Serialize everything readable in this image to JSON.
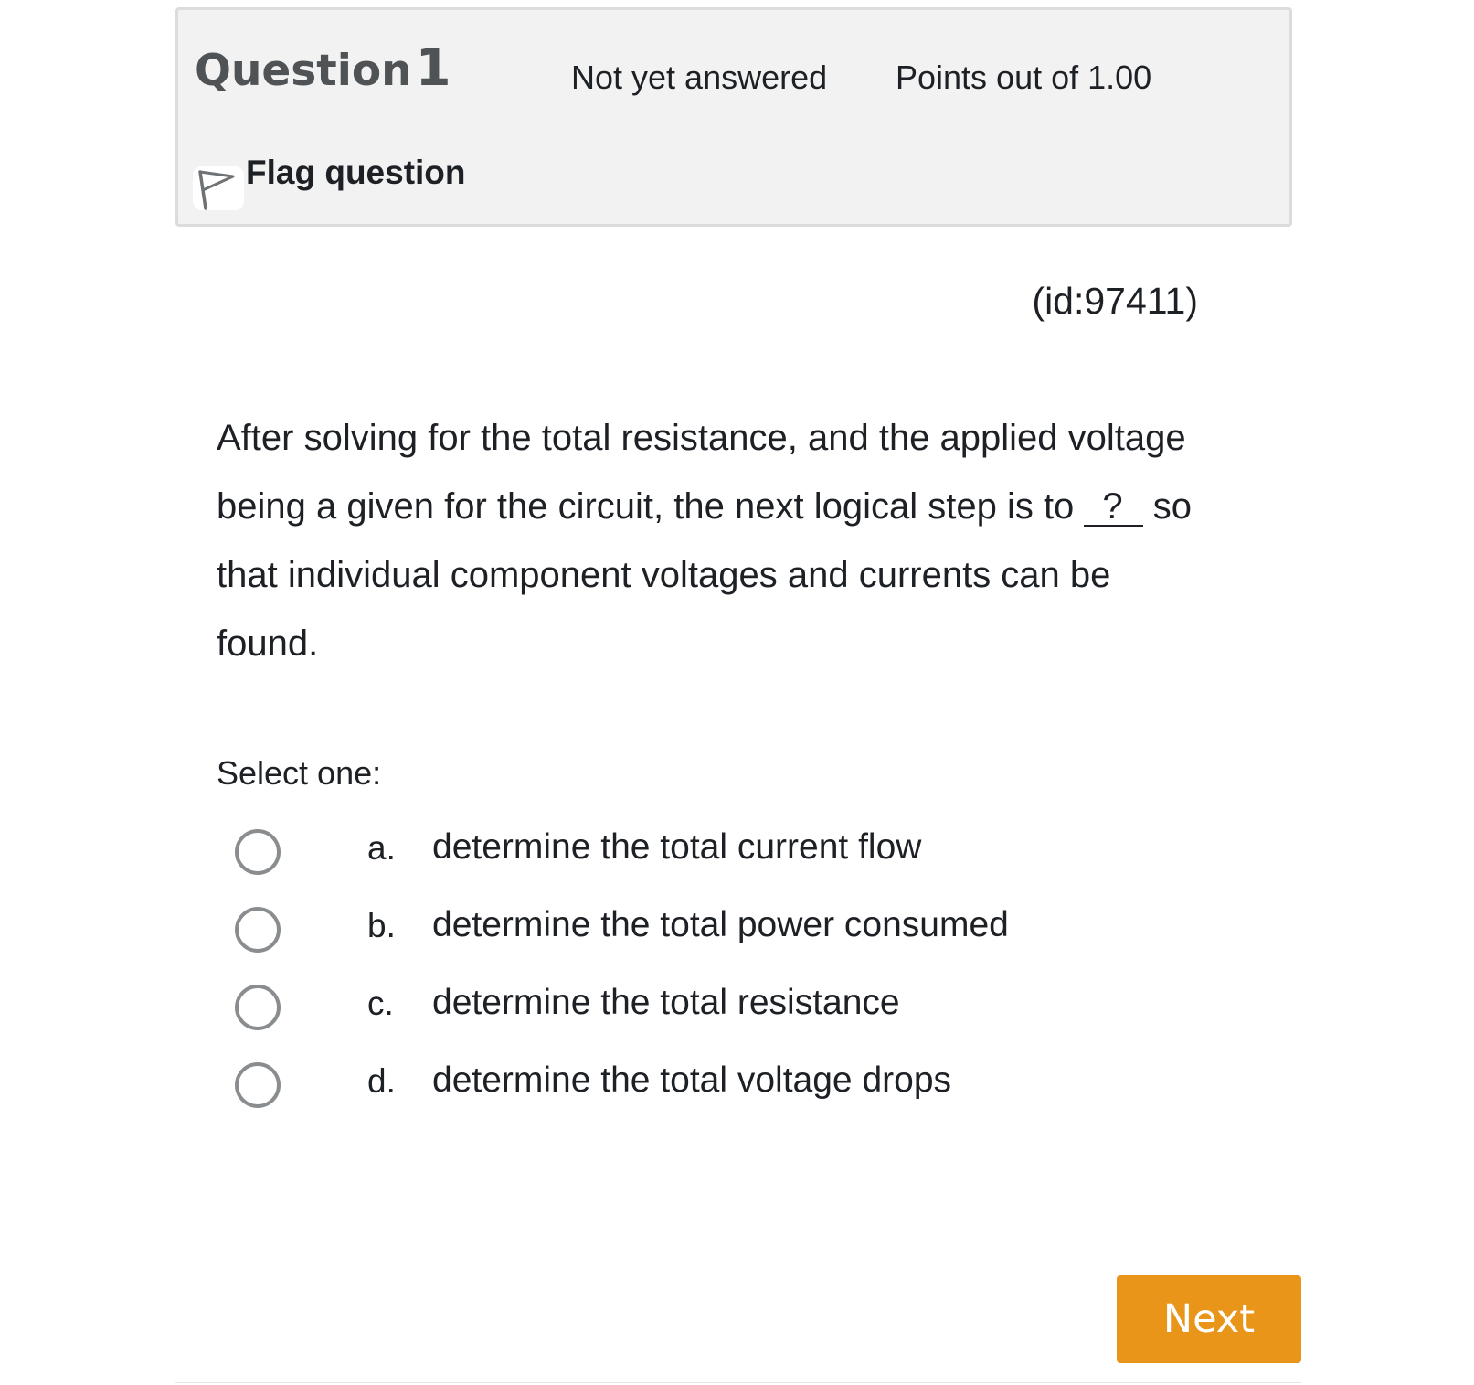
{
  "header": {
    "question_label": "Question",
    "question_number": "1",
    "state": "Not yet answered",
    "points": "Points out of 1.00",
    "flag_label": "Flag question"
  },
  "question": {
    "id_text": "(id:97411)",
    "text_before": "After solving for the total resistance, and the applied voltage being a given for the circuit, the next logical step is to ",
    "blank": "?",
    "text_after": " so that individual component voltages and currents can be found."
  },
  "prompt": "Select one:",
  "answers": [
    {
      "letter": "a.",
      "text": "determine the total current flow"
    },
    {
      "letter": "b.",
      "text": "determine the total power consumed"
    },
    {
      "letter": "c.",
      "text": "determine the total resistance"
    },
    {
      "letter": "d.",
      "text": "determine the total voltage drops"
    }
  ],
  "navigation": {
    "next_label": "Next"
  },
  "colors": {
    "header_background": "#f2f2f2",
    "next_button": "#e8951a",
    "radio_border": "#8a8d90"
  }
}
